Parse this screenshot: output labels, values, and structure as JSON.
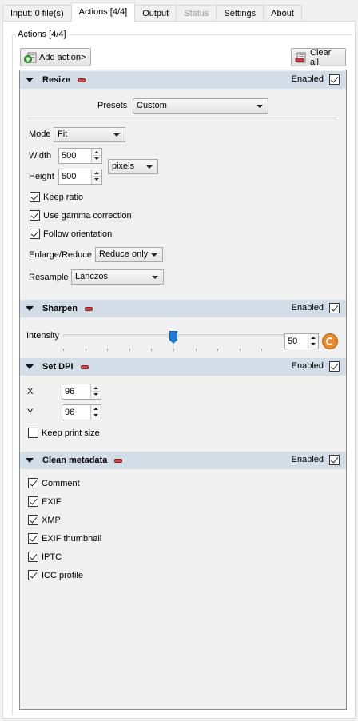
{
  "tabs": [
    {
      "label": "Input: 0 file(s)",
      "state": "normal"
    },
    {
      "label": "Actions [4/4]",
      "state": "active"
    },
    {
      "label": "Output",
      "state": "normal"
    },
    {
      "label": "Status",
      "state": "disabled"
    },
    {
      "label": "Settings",
      "state": "normal"
    },
    {
      "label": "About",
      "state": "normal"
    }
  ],
  "group_title": "Actions [4/4]",
  "toolbar": {
    "add_label": "Add action>",
    "add_icon": "add-action-icon",
    "clear_label": "Clear all",
    "clear_icon": "clear-all-icon"
  },
  "enabled_label": "Enabled",
  "resize": {
    "title": "Resize",
    "enabled": true,
    "presets_label": "Presets",
    "presets_value": "Custom",
    "mode_label": "Mode",
    "mode_value": "Fit",
    "width_label": "Width",
    "width_value": "500",
    "height_label": "Height",
    "height_value": "500",
    "unit_value": "pixels",
    "keep_ratio_label": "Keep ratio",
    "keep_ratio": true,
    "gamma_label": "Use gamma correction",
    "gamma": true,
    "orientation_label": "Follow orientation",
    "orientation": true,
    "enlarge_label": "Enlarge/Reduce",
    "enlarge_value": "Reduce only",
    "resample_label": "Resample",
    "resample_value": "Lanczos"
  },
  "sharpen": {
    "title": "Sharpen",
    "enabled": true,
    "intensity_label": "Intensity",
    "intensity_value": "50",
    "intensity_fraction": 0.5
  },
  "setdpi": {
    "title": "Set DPI",
    "enabled": true,
    "x_label": "X",
    "x_value": "96",
    "y_label": "Y",
    "y_value": "96",
    "keep_print_label": "Keep print size",
    "keep_print": false
  },
  "metadata": {
    "title": "Clean metadata",
    "enabled": true,
    "items": [
      {
        "label": "Comment",
        "checked": true
      },
      {
        "label": "EXIF",
        "checked": true
      },
      {
        "label": "XMP",
        "checked": true
      },
      {
        "label": "EXIF thumbnail",
        "checked": true
      },
      {
        "label": "IPTC",
        "checked": true
      },
      {
        "label": "ICC profile",
        "checked": true
      }
    ]
  }
}
